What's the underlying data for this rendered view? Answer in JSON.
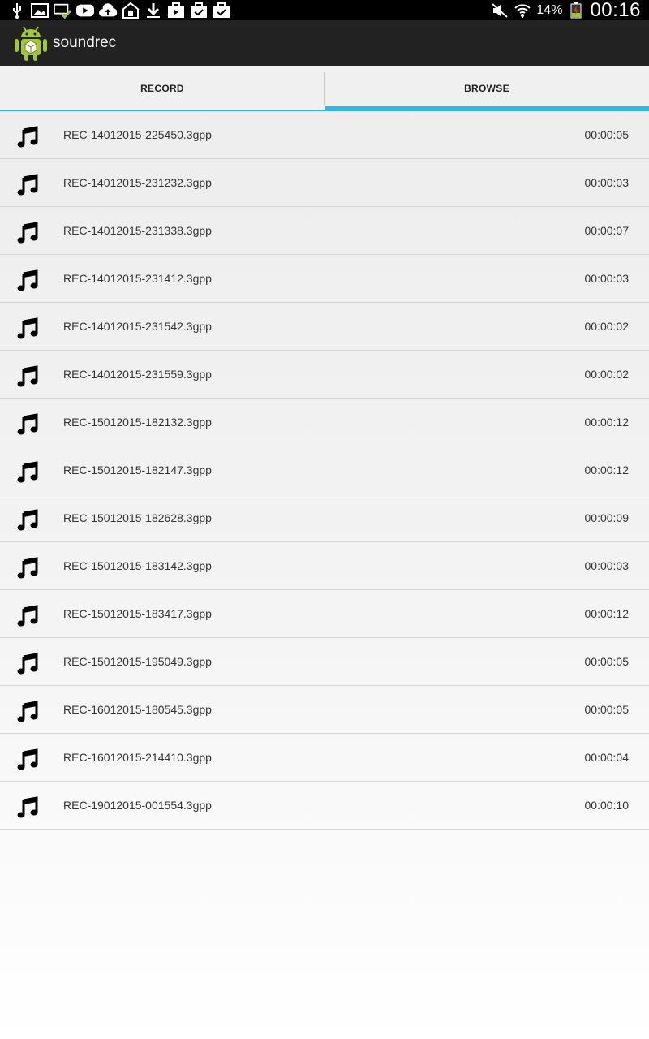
{
  "status_bar": {
    "left_icons": [
      "usb-icon",
      "gallery-icon",
      "screen-check-icon",
      "youtube-icon",
      "cloud-upload-icon",
      "store-icon",
      "download-icon",
      "briefcase-play-icon",
      "briefcase-check-icon",
      "briefcase-check-icon"
    ],
    "battery_percent": "14%",
    "time": "00:16"
  },
  "action_bar": {
    "title": "soundrec"
  },
  "tabs": [
    {
      "label": "RECORD",
      "selected": false
    },
    {
      "label": "BROWSE",
      "selected": true
    }
  ],
  "recordings": [
    {
      "name": "REC-14012015-225450.3gpp",
      "duration": "00:00:05"
    },
    {
      "name": "REC-14012015-231232.3gpp",
      "duration": "00:00:03"
    },
    {
      "name": "REC-14012015-231338.3gpp",
      "duration": "00:00:07"
    },
    {
      "name": "REC-14012015-231412.3gpp",
      "duration": "00:00:03"
    },
    {
      "name": "REC-14012015-231542.3gpp",
      "duration": "00:00:02"
    },
    {
      "name": "REC-14012015-231559.3gpp",
      "duration": "00:00:02"
    },
    {
      "name": "REC-15012015-182132.3gpp",
      "duration": "00:00:12"
    },
    {
      "name": "REC-15012015-182147.3gpp",
      "duration": "00:00:12"
    },
    {
      "name": "REC-15012015-182628.3gpp",
      "duration": "00:00:09"
    },
    {
      "name": "REC-15012015-183142.3gpp",
      "duration": "00:00:03"
    },
    {
      "name": "REC-15012015-183417.3gpp",
      "duration": "00:00:12"
    },
    {
      "name": "REC-15012015-195049.3gpp",
      "duration": "00:00:05"
    },
    {
      "name": "REC-16012015-180545.3gpp",
      "duration": "00:00:05"
    },
    {
      "name": "REC-16012015-214410.3gpp",
      "duration": "00:00:04"
    },
    {
      "name": "REC-19012015-001554.3gpp",
      "duration": "00:00:10"
    }
  ],
  "colors": {
    "accent": "#33b5e5",
    "action_bar": "#222222",
    "status_bar": "#000000"
  }
}
